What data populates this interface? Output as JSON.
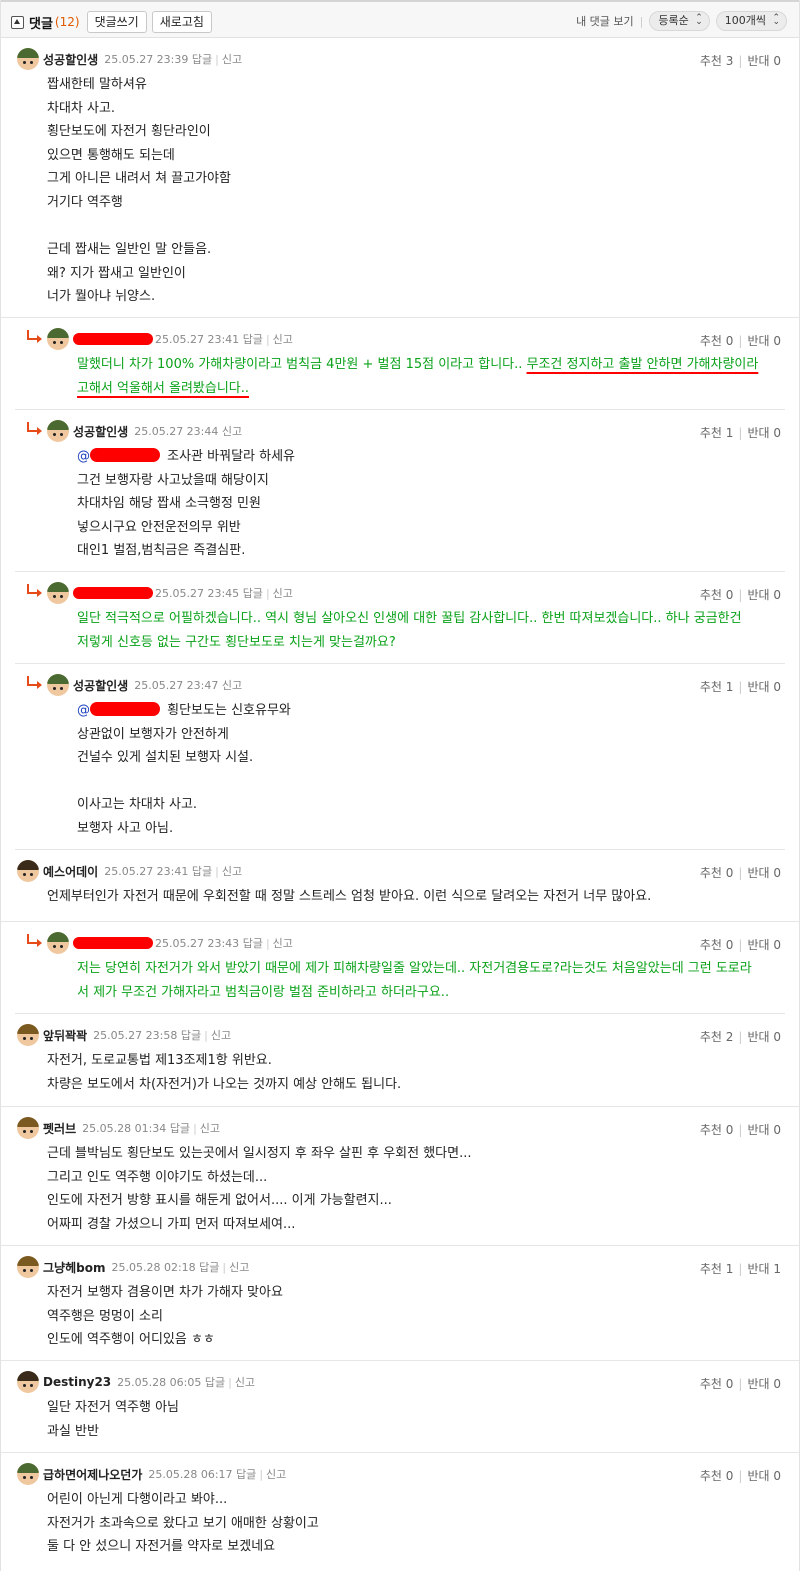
{
  "header": {
    "title": "댓글",
    "count": "(12)",
    "write_btn": "댓글쓰기",
    "refresh_btn": "새로고침",
    "my_comments": "내 댓글 보기",
    "sort_select": "등록순",
    "per_page_select": "100개씩"
  },
  "labels": {
    "reply": "답글",
    "report": "신고",
    "up": "추천",
    "down": "반대"
  },
  "comments": [
    {
      "nick": "성공할인생",
      "date": "25.05.27 23:39",
      "up": "3",
      "down": "0",
      "lines": "짭새한테 말하셔유\n차대차 사고.\n횡단보도에 자전거 횡단라인이\n있으면 통행해도 되는데\n그게 아니믄 내려서 쳐 끌고가야함\n거기다 역주행\n\n근데 짭새는 일반인 말 안들음.\n왜? 지가 짭새고 일반인이\n너가 뭘아냐 뉘양스."
    },
    {
      "nick": "",
      "date": "25.05.27 23:41",
      "up": "0",
      "down": "0",
      "line1_a": "말했더니 차가 100% 가해차량이라고 범칙금 4만원 + 벌점 15점 이라고 합니다.. ",
      "line1_b": "무조건 정지하고 출발 안하면 가해차량이라",
      "line2": "고해서 억울해서 올려봤습니다.."
    },
    {
      "nick": "성공할인생",
      "date": "25.05.27 23:44",
      "up": "1",
      "down": "0",
      "mention_tail": " 조사관 바꿔달라 하세유",
      "lines": "그건 보행자랑 사고났을때 해당이지\n차대차임 해당 짭새 소극행정 민원\n넣으시구요 안전운전의무 위반\n대인1 벌점,범칙금은 즉결심판."
    },
    {
      "nick": "",
      "date": "25.05.27 23:45",
      "up": "0",
      "down": "0",
      "lines": "일단 적극적으로 어필하겠습니다.. 역시 형님 살아오신 인생에 대한 꿀팁 감사합니다.. 한번 따져보겠습니다.. 하나 궁금한건\n저렇게 신호등 없는 구간도 횡단보도로 치는게 맞는걸까요?"
    },
    {
      "nick": "성공할인생",
      "date": "25.05.27 23:47",
      "up": "1",
      "down": "0",
      "mention_tail": " 횡단보도는 신호유무와",
      "lines": "상관없이 보행자가 안전하게\n건널수 있게 설치된 보행자 시설.\n\n이사고는 차대차 사고.\n보행자 사고 아님."
    },
    {
      "nick": "예스어데이",
      "date": "25.05.27 23:41",
      "up": "0",
      "down": "0",
      "lines": "언제부터인가 자전거 때문에 우회전할 때 정말 스트레스 엄청 받아요. 이런 식으로 달려오는 자전거 너무 많아요."
    },
    {
      "nick": "",
      "date": "25.05.27 23:43",
      "up": "0",
      "down": "0",
      "lines": "저는 당연히 자전거가 와서 받았기 때문에 제가 피해차량일줄 알았는데.. 자전거겸용도로?라는것도 처음알았는데 그런 도로라\n서 제가 무조건 가해자라고 범칙금이랑 벌점 준비하라고 하더라구요.."
    },
    {
      "nick": "앞뒤꽉꽉",
      "date": "25.05.27 23:58",
      "up": "2",
      "down": "0",
      "lines": "자전거, 도로교통법 제13조제1항 위반요.\n차량은 보도에서 차(자전거)가 나오는 것까지 예상 안해도 됩니다."
    },
    {
      "nick": "펫러브",
      "date": "25.05.28 01:34",
      "up": "0",
      "down": "0",
      "lines": "근데 블박님도 횡단보도 있는곳에서 일시정지 후 좌우 살핀 후 우회전 했다면...\n그리고 인도 역주행 이야기도 하셨는데...\n인도에 자전거 방향 표시를 해둔게 없어서.... 이게 가능할련지...\n어짜피 경찰 가셨으니 가피 먼저 따져보세여..."
    },
    {
      "nick": "그냥헤bom",
      "date": "25.05.28 02:18",
      "up": "1",
      "down": "1",
      "lines": "자전거 보행자 겸용이면 차가 가해자 맞아요\n역주행은 멍멍이 소리\n인도에 역주행이 어디있음 ㅎㅎ"
    },
    {
      "nick": "Destiny23",
      "date": "25.05.28 06:05",
      "up": "0",
      "down": "0",
      "lines": "일단 자전거 역주행 아님\n과실 반반"
    },
    {
      "nick": "급하면어제나오던가",
      "date": "25.05.28 06:17",
      "up": "0",
      "down": "0",
      "lines": "어린이 아닌게 다행이라고 봐야...\n자전거가 초과속으로 왔다고 보기 애매한 상황이고\n둘 다 안 섰으니 자전거를 약자로 보겠네요"
    }
  ]
}
